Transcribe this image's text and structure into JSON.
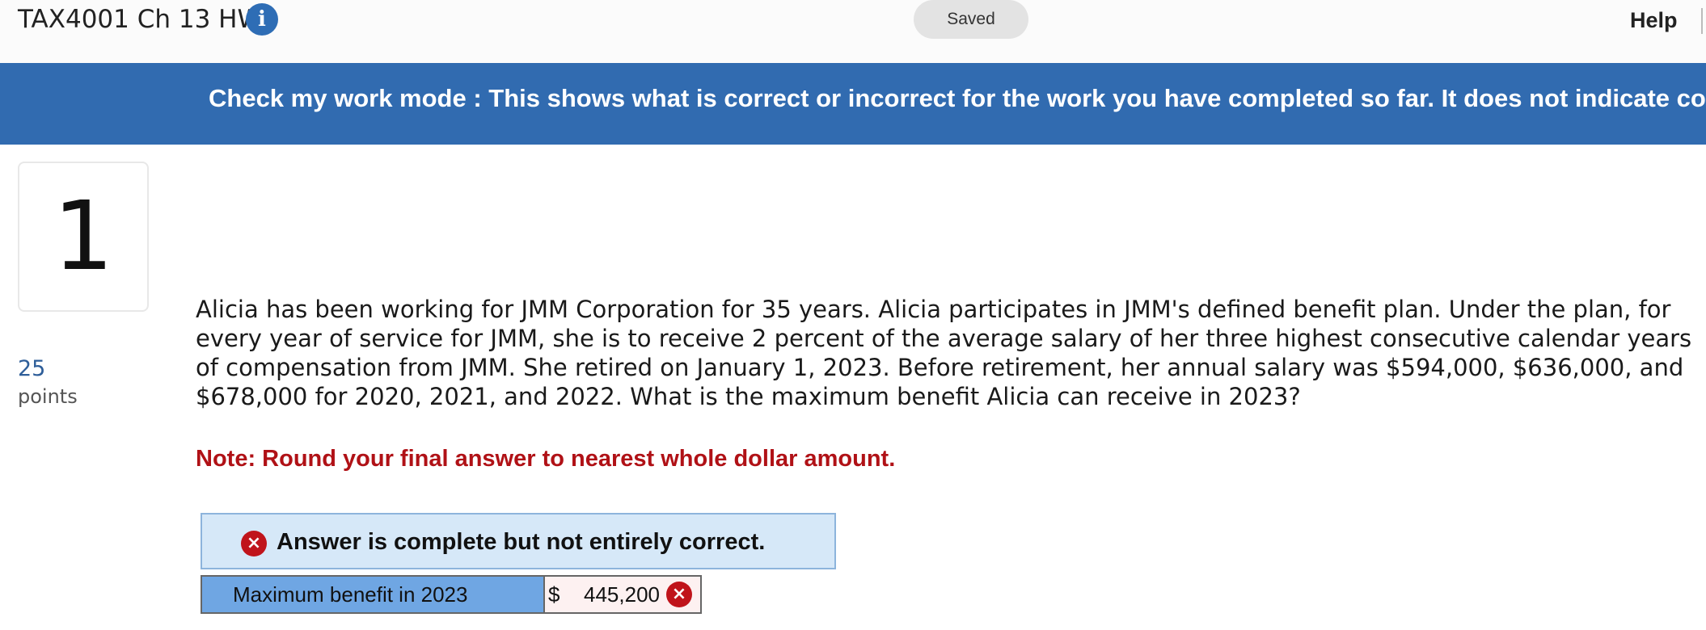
{
  "header": {
    "assignment_title": "TAX4001 Ch 13 HW",
    "info_icon": "i",
    "saved_status": "Saved",
    "help_label": "Help"
  },
  "banner": {
    "text": "Check my work mode : This shows what is correct or incorrect for the work you have completed so far. It does not indicate compl"
  },
  "question": {
    "number": "1",
    "points_value": "25",
    "points_label": "points",
    "text": "Alicia has been working for JMM Corporation for 35 years. Alicia participates in JMM's defined benefit plan. Under the plan, for every year of service for JMM, she is to receive 2 percent of the average salary of her three highest consecutive calendar years of compensation from JMM. She retired on January 1, 2023. Before retirement, her annual salary was $594,000, $636,000, and $678,000 for 2020, 2021, and 2022. What is the maximum benefit Alicia can receive in 2023?",
    "note": "Note: Round your final answer to nearest whole dollar amount."
  },
  "result": {
    "icon": "×",
    "status_text": "Answer is complete but not entirely correct."
  },
  "answer": {
    "label": "Maximum benefit in 2023",
    "currency": "$",
    "value": "445,200",
    "status_icon": "×"
  },
  "colors": {
    "banner": "#316bb0",
    "note": "#b01116",
    "error_icon": "#c0141b",
    "result_box": "#d6e8f8",
    "answer_label_cell": "#6fa6e3"
  }
}
